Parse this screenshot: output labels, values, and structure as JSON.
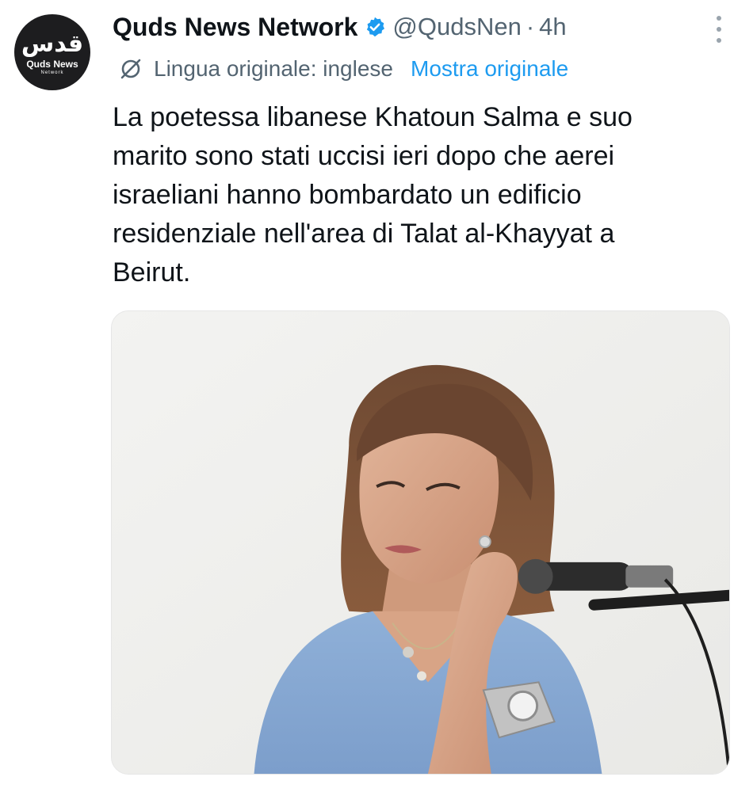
{
  "account": {
    "avatar_mark": "قدس",
    "avatar_brand": "Quds News",
    "avatar_sub": "Network",
    "display_name": "Quds News Network",
    "handle": "@QudsNen",
    "separator": "·",
    "time": "4h"
  },
  "translation": {
    "label": "Lingua originale: inglese",
    "show_original": "Mostra originale"
  },
  "post": {
    "text": "La poetessa libanese Khatoun Salma e suo\nmarito sono stati uccisi ieri dopo che aerei\nisraeliani hanno bombardato un edificio\nresidenziale nell'area di Talat al-Khayyat a\nBeirut."
  },
  "colors": {
    "verified": "#1d9bf0",
    "link": "#1d9bf0",
    "secondary_text": "#536471"
  },
  "icons": {
    "verified": "verified-badge-icon",
    "translate": "translate-icon",
    "more": "more-options-icon"
  }
}
